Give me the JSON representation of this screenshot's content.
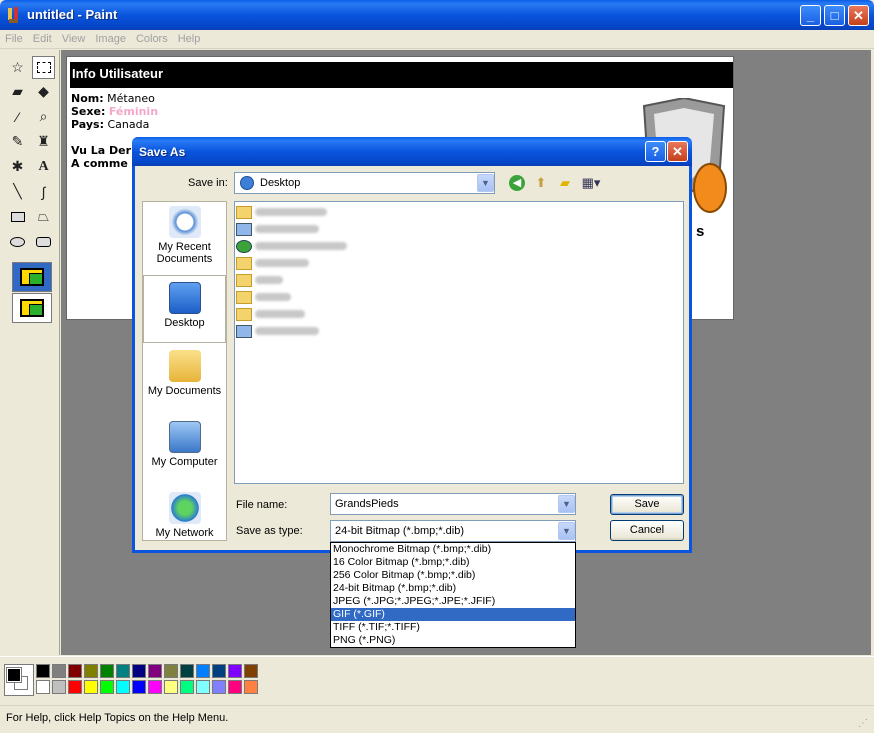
{
  "window": {
    "title": "untitled - Paint",
    "minimize": "_",
    "maximize": "□",
    "close": "✕"
  },
  "menu": [
    "File",
    "Edit",
    "View",
    "Image",
    "Colors",
    "Help"
  ],
  "image": {
    "header": "Info Utilisateur",
    "lines": [
      {
        "label": "Nom:",
        "value": "Métaneo"
      },
      {
        "label": "Sexe:",
        "value": "Féminin"
      },
      {
        "label": "Pays:",
        "value": "Canada"
      }
    ],
    "line4": "Vu La Der",
    "line5": "A comme",
    "logo_text": "s"
  },
  "dialog": {
    "title": "Save As",
    "help_button": "?",
    "close_button": "✕",
    "save_in_label": "Save in:",
    "save_in_value": "Desktop",
    "places": [
      "My Recent Documents",
      "Desktop",
      "My Documents",
      "My Computer",
      "My Network"
    ],
    "file_name_label": "File name:",
    "file_name_value": "GrandsPieds",
    "save_as_type_label": "Save as type:",
    "save_as_type_value": "24-bit Bitmap (*.bmp;*.dib)",
    "save_button": "Save",
    "cancel_button": "Cancel",
    "type_options": [
      "Monochrome Bitmap (*.bmp;*.dib)",
      "16 Color Bitmap (*.bmp;*.dib)",
      "256 Color Bitmap (*.bmp;*.dib)",
      "24-bit Bitmap (*.bmp;*.dib)",
      "JPEG (*.JPG;*.JPEG;*.JPE;*.JFIF)",
      "GIF (*.GIF)",
      "TIFF (*.TIF;*.TIFF)",
      "PNG (*.PNG)"
    ],
    "selected_type_index": 5
  },
  "palette": {
    "row1": [
      "#000000",
      "#808080",
      "#800000",
      "#808000",
      "#008000",
      "#008080",
      "#000080",
      "#800080",
      "#808040",
      "#004040",
      "#0080ff",
      "#004080",
      "#8000ff",
      "#804000"
    ],
    "row2": [
      "#ffffff",
      "#c0c0c0",
      "#ff0000",
      "#ffff00",
      "#00ff00",
      "#00ffff",
      "#0000ff",
      "#ff00ff",
      "#ffff80",
      "#00ff80",
      "#80ffff",
      "#8080ff",
      "#ff0080",
      "#ff8040"
    ]
  },
  "status": {
    "text": "For Help, click Help Topics on the Help Menu."
  }
}
